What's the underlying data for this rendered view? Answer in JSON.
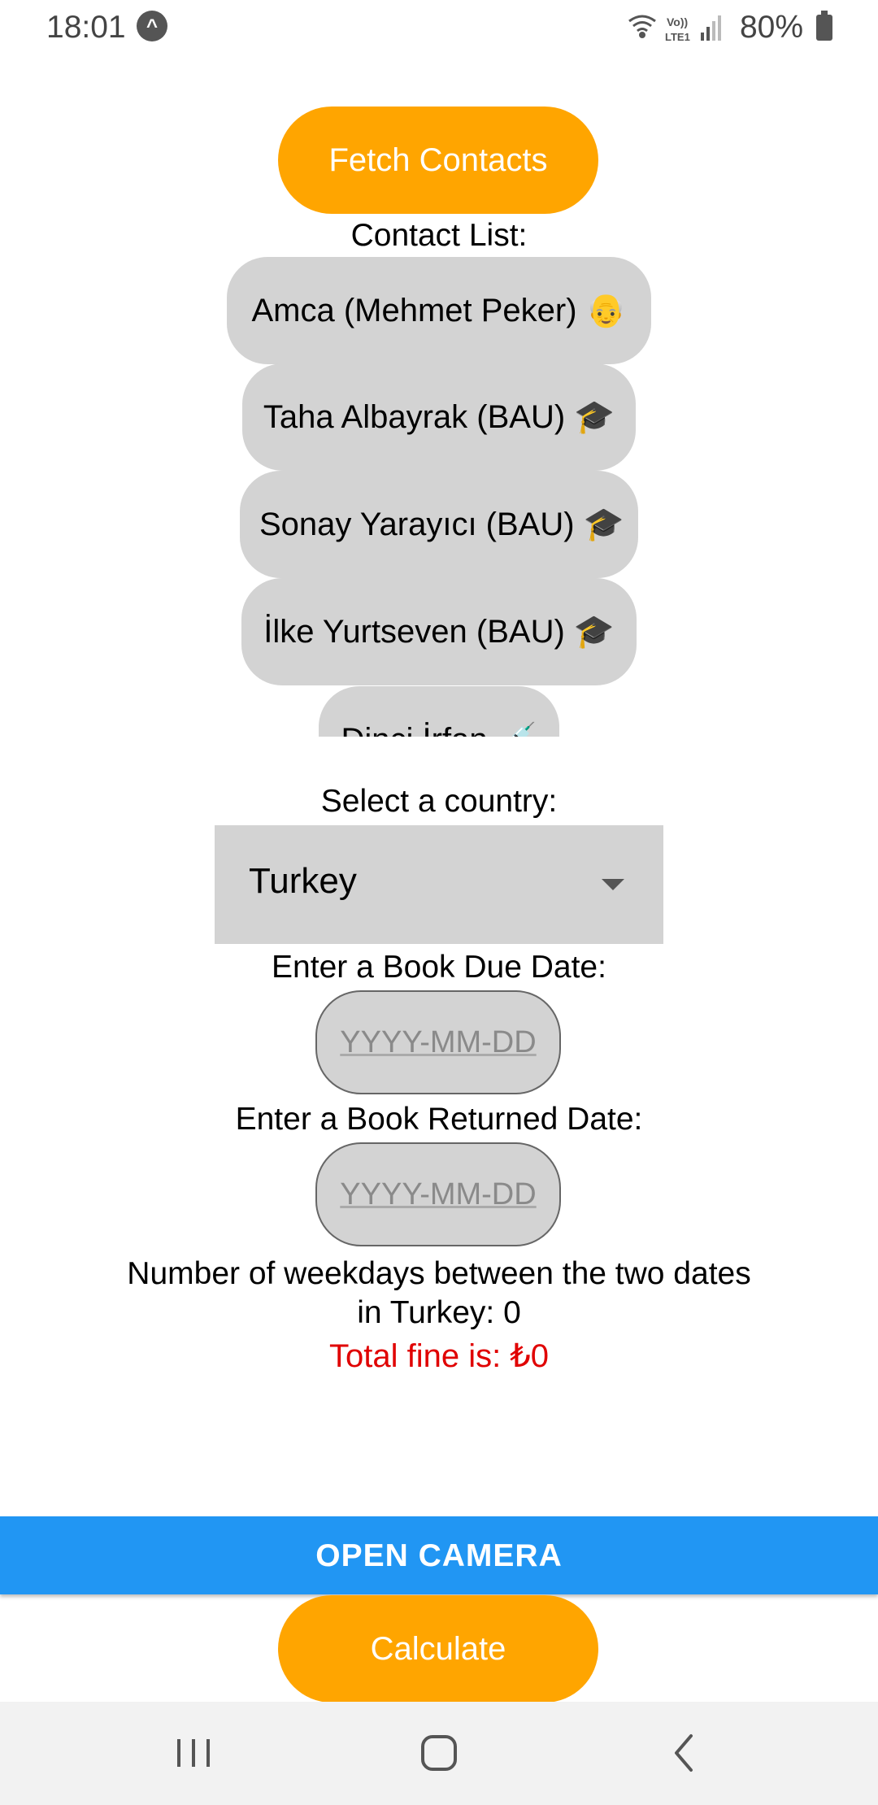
{
  "status_bar": {
    "time": "18:01",
    "expo_badge": "^",
    "battery": "80%",
    "icons": [
      "wifi-icon",
      "volte-lte-icon",
      "signal-icon",
      "battery-icon"
    ],
    "volte_label": "VoLTE1"
  },
  "fetch_button": {
    "label": "Fetch Contacts",
    "color": "#FFA500"
  },
  "contact_list": {
    "label": "Contact List:",
    "items": [
      {
        "name": "Amca (Mehmet Peker)",
        "emoji": "👴"
      },
      {
        "name": "Taha Albayrak (BAU)",
        "emoji": "🎓"
      },
      {
        "name": "Sonay Yarayıcı (BAU)",
        "emoji": "🎓"
      },
      {
        "name": "İlke Yurtseven (BAU)",
        "emoji": "🎓"
      },
      {
        "name": "Dinçi İrfan",
        "emoji": "💉"
      }
    ]
  },
  "country": {
    "label": "Select a country:",
    "selected": "Turkey"
  },
  "due_date": {
    "label": "Enter a Book Due Date:",
    "placeholder": "YYYY-MM-DD",
    "value": ""
  },
  "returned_date": {
    "label": "Enter a Book Returned Date:",
    "placeholder": "YYYY-MM-DD",
    "value": ""
  },
  "result": {
    "weekdays_text": "Number of weekdays between the two dates in Turkey: 0",
    "fine_text": "Total fine is: ₺0",
    "fine_color": "#E00000"
  },
  "camera_button": {
    "label": "OPEN CAMERA",
    "color": "#2196F3"
  },
  "calculate_button": {
    "label": "Calculate",
    "color": "#FFA500"
  },
  "nav_bar": {
    "buttons": [
      "recents-icon",
      "home-icon",
      "back-icon"
    ]
  }
}
